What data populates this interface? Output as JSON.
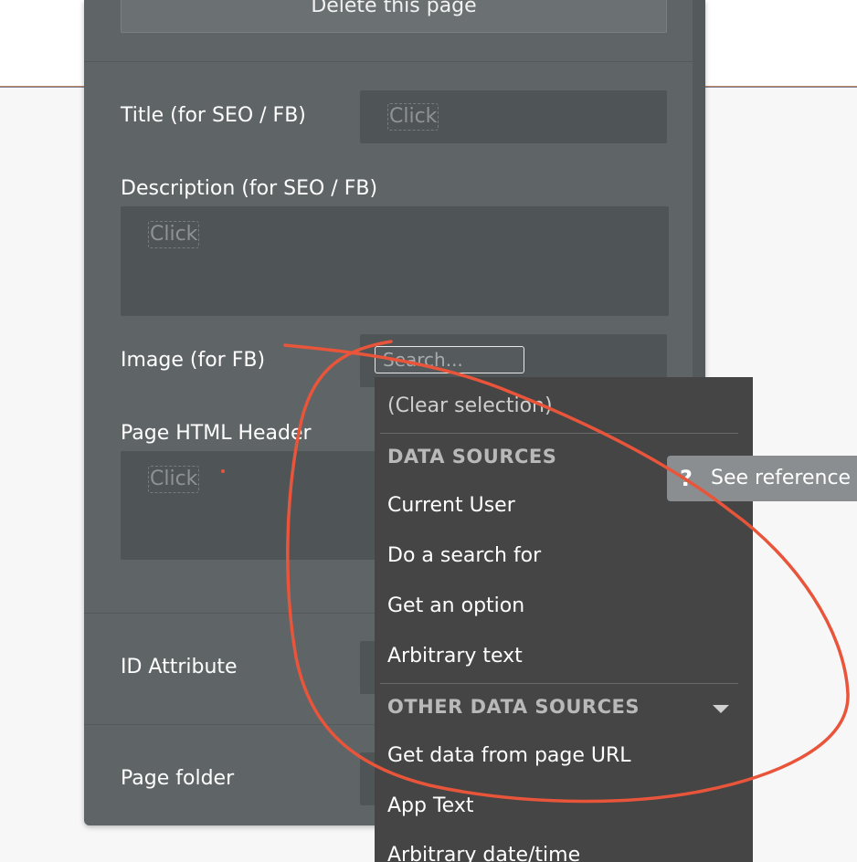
{
  "panel": {
    "delete_button": "Delete this page",
    "fields": {
      "title_label": "Title (for SEO / FB)",
      "title_value": "Click",
      "description_label": "Description (for SEO / FB)",
      "description_value": "Click",
      "image_label": "Image (for FB)",
      "header_label": "Page HTML Header",
      "header_value": "Click",
      "id_label": "ID Attribute",
      "folder_label": "Page folder"
    }
  },
  "search": {
    "placeholder": "Search..."
  },
  "dropdown": {
    "clear": "(Clear selection)",
    "data_sources_header": "DATA SOURCES",
    "data_sources": [
      "Current User",
      "Do a search for",
      "Get an option",
      "Arbitrary text"
    ],
    "other_header": "OTHER DATA SOURCES",
    "other_sources": [
      "Get data from page URL",
      "App Text",
      "Arbitrary date/time"
    ]
  },
  "tooltip": {
    "icon": "question-icon",
    "glyph": "?",
    "text": "See reference"
  },
  "colors": {
    "panel": "#5f6466",
    "field": "#4f5456",
    "dropdown": "#454545",
    "annotation": "#e8553a"
  }
}
